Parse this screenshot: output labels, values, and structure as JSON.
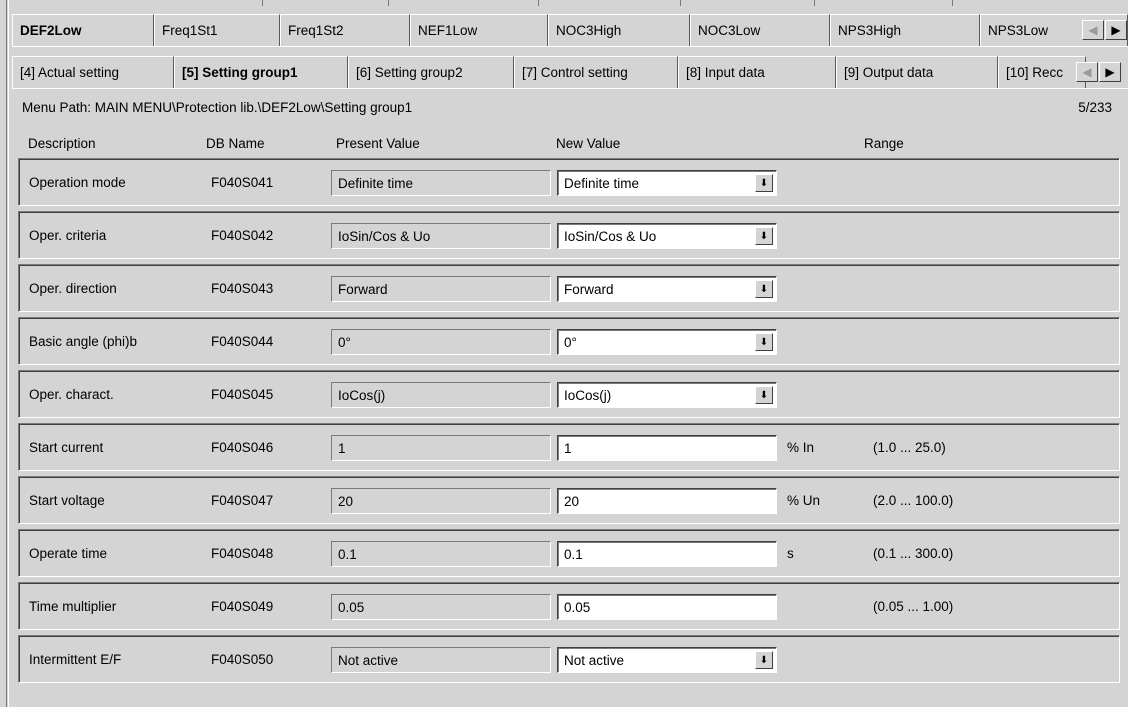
{
  "module_tabs": [
    {
      "label": "DEF2Low",
      "active": true
    },
    {
      "label": "Freq1St1",
      "active": false
    },
    {
      "label": "Freq1St2",
      "active": false
    },
    {
      "label": "NEF1Low",
      "active": false
    },
    {
      "label": "NOC3High",
      "active": false
    },
    {
      "label": "NOC3Low",
      "active": false
    },
    {
      "label": "NPS3High",
      "active": false
    },
    {
      "label": "NPS3Low",
      "active": false
    }
  ],
  "section_tabs": [
    {
      "label": "[4] Actual setting",
      "active": false
    },
    {
      "label": "[5] Setting group1",
      "active": true
    },
    {
      "label": "[6] Setting group2",
      "active": false
    },
    {
      "label": "[7] Control setting",
      "active": false
    },
    {
      "label": "[8] Input data",
      "active": false
    },
    {
      "label": "[9] Output data",
      "active": false
    },
    {
      "label": "[10] Recc",
      "active": false
    }
  ],
  "scroll_icons": {
    "left": "arrow-left-icon",
    "right": "arrow-right-icon"
  },
  "menu_path": "Menu Path:  MAIN MENU\\Protection lib.\\DEF2Low\\Setting group1",
  "page_count": "5/233",
  "columns": {
    "description": "Description",
    "db_name": "DB Name",
    "present_value": "Present Value",
    "new_value": "New Value",
    "range": "Range"
  },
  "rows": [
    {
      "description": "Operation mode",
      "db_name": "F040S041",
      "present": "Definite time",
      "new": "Definite time",
      "type": "select",
      "unit": "",
      "range": ""
    },
    {
      "description": "Oper. criteria",
      "db_name": "F040S042",
      "present": "IoSin/Cos & Uo",
      "new": "IoSin/Cos & Uo",
      "type": "select",
      "unit": "",
      "range": ""
    },
    {
      "description": "Oper. direction",
      "db_name": "F040S043",
      "present": "Forward",
      "new": "Forward",
      "type": "select",
      "unit": "",
      "range": ""
    },
    {
      "description": "Basic angle (phi)b",
      "db_name": "F040S044",
      "present": "0°",
      "new": "0°",
      "type": "select",
      "unit": "",
      "range": ""
    },
    {
      "description": "Oper. charact.",
      "db_name": "F040S045",
      "present": "IoCos(j)",
      "new": "IoCos(j)",
      "type": "select",
      "unit": "",
      "range": ""
    },
    {
      "description": "Start current",
      "db_name": "F040S046",
      "present": "1",
      "new": "1",
      "type": "input",
      "unit": "% In",
      "range": "(1.0 ... 25.0)"
    },
    {
      "description": "Start voltage",
      "db_name": "F040S047",
      "present": "20",
      "new": "20",
      "type": "input",
      "unit": "% Un",
      "range": "(2.0 ... 100.0)"
    },
    {
      "description": "Operate time",
      "db_name": "F040S048",
      "present": "0.1",
      "new": "0.1",
      "type": "input",
      "unit": "s",
      "range": "(0.1 ... 300.0)"
    },
    {
      "description": "Time multiplier",
      "db_name": "F040S049",
      "present": "0.05",
      "new": "0.05",
      "type": "input",
      "unit": "",
      "range": "(0.05 ... 1.00)"
    },
    {
      "description": "Intermittent E/F",
      "db_name": "F040S050",
      "present": "Not active",
      "new": "Not active",
      "type": "select",
      "unit": "",
      "range": ""
    }
  ]
}
